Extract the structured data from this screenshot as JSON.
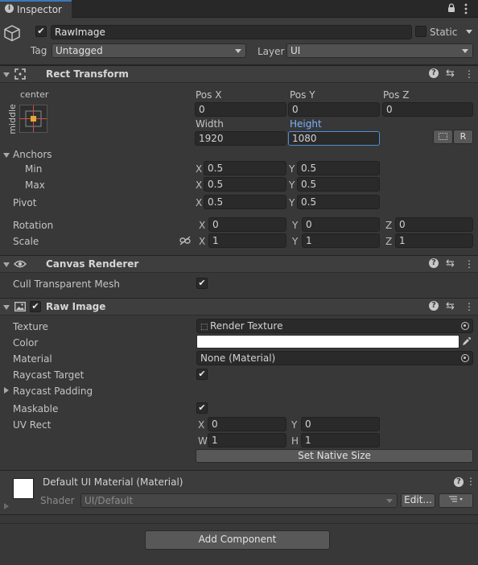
{
  "window": {
    "tab_title": "Inspector"
  },
  "gameobject": {
    "active": true,
    "name": "RawImage",
    "static_label": "Static",
    "static_checked": false,
    "tag_label": "Tag",
    "tag_value": "Untagged",
    "layer_label": "Layer",
    "layer_value": "UI"
  },
  "rect_transform": {
    "title": "Rect Transform",
    "anchor_h": "center",
    "anchor_v": "middle",
    "pos_x_label": "Pos X",
    "pos_y_label": "Pos Y",
    "pos_z_label": "Pos Z",
    "pos_x": "0",
    "pos_y": "0",
    "pos_z": "0",
    "width_label": "Width",
    "height_label": "Height",
    "width": "1920",
    "height": "1080",
    "r_button": "R",
    "anchors_label": "Anchors",
    "min_label": "Min",
    "max_label": "Max",
    "min_x": "0.5",
    "min_y": "0.5",
    "max_x": "0.5",
    "max_y": "0.5",
    "pivot_label": "Pivot",
    "pivot_x": "0.5",
    "pivot_y": "0.5",
    "rotation_label": "Rotation",
    "rot_x": "0",
    "rot_y": "0",
    "rot_z": "0",
    "scale_label": "Scale",
    "scale_x": "1",
    "scale_y": "1",
    "scale_z": "1",
    "axis_x": "X",
    "axis_y": "Y",
    "axis_z": "Z"
  },
  "canvas_renderer": {
    "title": "Canvas Renderer",
    "cull_label": "Cull Transparent Mesh",
    "cull_checked": true
  },
  "raw_image": {
    "title": "Raw Image",
    "enabled": true,
    "texture_label": "Texture",
    "texture_value": "Render Texture",
    "color_label": "Color",
    "color_value": "#ffffff",
    "material_label": "Material",
    "material_value": "None (Material)",
    "raycast_target_label": "Raycast Target",
    "raycast_target_checked": true,
    "raycast_padding_label": "Raycast Padding",
    "maskable_label": "Maskable",
    "maskable_checked": true,
    "uv_rect_label": "UV Rect",
    "uv_x_label": "X",
    "uv_y_label": "Y",
    "uv_w_label": "W",
    "uv_h_label": "H",
    "uv_x": "0",
    "uv_y": "0",
    "uv_w": "1",
    "uv_h": "1",
    "native_size_button": "Set Native Size"
  },
  "material_section": {
    "title": "Default UI Material (Material)",
    "shader_label": "Shader",
    "shader_value": "UI/Default",
    "edit_button": "Edit..."
  },
  "footer": {
    "add_component_button": "Add Component"
  },
  "colors": {
    "accent_blue": "#7bb2ff",
    "bg": "#383838",
    "field": "#2a2a2a"
  }
}
